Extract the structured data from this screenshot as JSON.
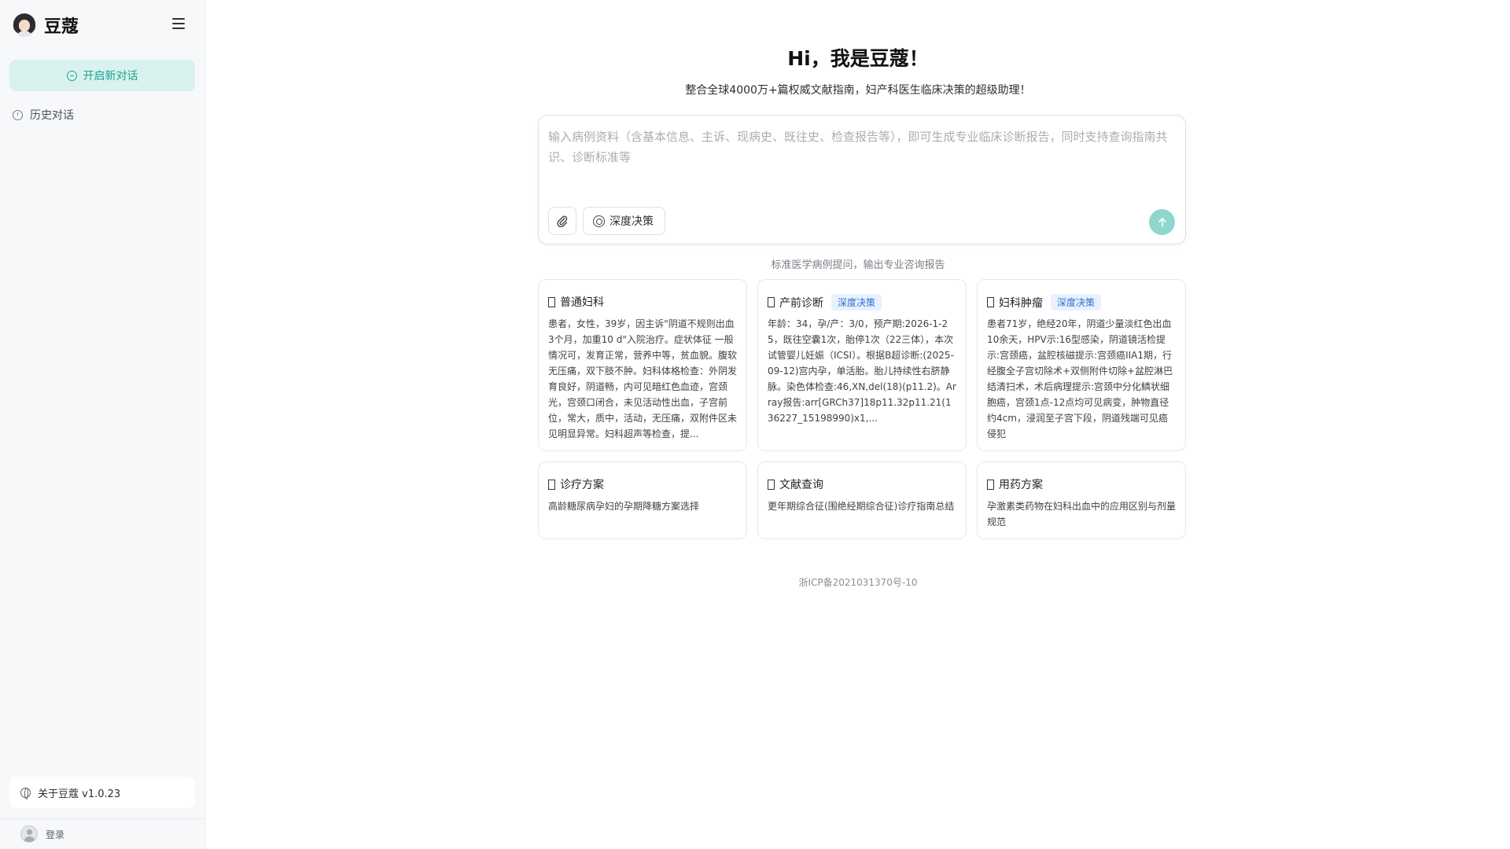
{
  "sidebar": {
    "brand_name": "豆蔻",
    "new_chat_label": "开启新对话",
    "history_label": "历史对话",
    "about_label": "关于豆蔻 v1.0.23",
    "login_label": "登录"
  },
  "main": {
    "title": "Hi，我是豆蔻！",
    "subtitle": "整合全球4000万+篇权威文献指南，妇产科医生临床决策的超级助理！",
    "input_placeholder": "输入病例资料（含基本信息、主诉、现病史、既往史、检查报告等），即可生成专业临床诊断报告，同时支持查询指南共识、诊断标准等",
    "deep_decision_label": "深度决策",
    "hint": "标准医学病例提问，输出专业咨询报告",
    "cards": [
      {
        "title": "普通妇科",
        "tag": "",
        "text": "患者，女性，39岁，因主诉\"阴道不规则出血3个月，加重10 d\"入院治疗。症状体征 一般情况可，发育正常，营养中等，贫血貌。腹软无压痛，双下肢不肿。妇科体格检查：外阴发育良好，阴道畅，内可见暗红色血迹，宫颈光，宫颈口闭合，未见活动性出血，子宫前位，常大，质中，活动，无压痛，双附件区未见明显异常。妇科超声等检查，提..."
      },
      {
        "title": "产前诊断",
        "tag": "深度决策",
        "text": "年龄：34，孕/产：3/0，预产期:2026-1-25，既往空囊1次，胎停1次（22三体），本次试管婴儿妊娠（ICSI）。根据B超诊断:(2025-09-12)宫内孕，单活胎。胎儿持续性右脐静脉。染色体检查:46,XN,del(18)(p11.2)。Array报告:arr[GRCh37]18p11.32p11.21(136227_15198990)x1,..."
      },
      {
        "title": "妇科肿瘤",
        "tag": "深度决策",
        "text": "患者71岁，绝经20年，阴道少量淡红色出血10余天，HPV示:16型感染，阴道镜活检提示:宫颈癌，盆腔核磁提示:宫颈癌IIA1期，行经腹全子宫切除术+双侧附件切除+盆腔淋巴结清扫术，术后病理提示:宫颈中分化鳞状细胞癌，宫颈1点-12点均可见病变，肿物直径约4cm，浸润至子宫下段，阴道残端可见癌侵犯"
      },
      {
        "title": "诊疗方案",
        "tag": "",
        "text": "高龄糖尿病孕妇的孕期降糖方案选择"
      },
      {
        "title": "文献查询",
        "tag": "",
        "text": "更年期综合征(围绝经期综合征)诊疗指南总结"
      },
      {
        "title": "用药方案",
        "tag": "",
        "text": "孕激素类药物在妇科出血中的应用区别与剂量规范"
      }
    ],
    "footer": "浙ICP备2021031370号-10"
  }
}
